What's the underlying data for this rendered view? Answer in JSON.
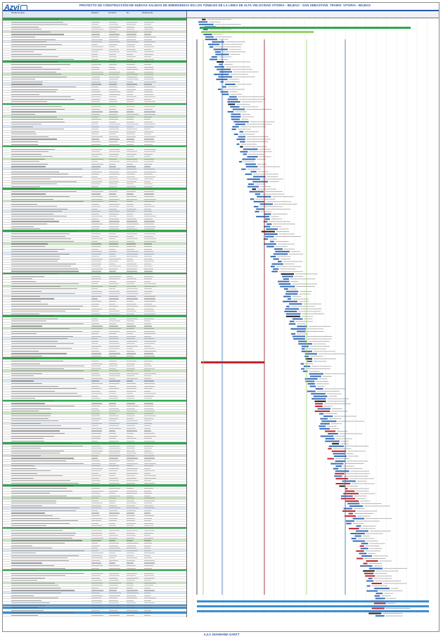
{
  "header": {
    "logo": "Azvi",
    "title": "PROYECTO DE CONSTRUCCIÓN DE NUEVAS SALIDAS DE EMERGENCIA EN LOS TÚNELES DE LA LÍNEA DE ALTA VELOCIDAD VITORIA - BILBAO - SAN SEBASTIÁN. TRAMO: VITORIA - BILBAO"
  },
  "table": {
    "columns": [
      "Nombre de tarea",
      "Duración",
      "Comienzo",
      "Fin",
      "Predecesoras"
    ]
  },
  "footer": {
    "caption": "A.2.2. DIAGRAMA GANTT"
  },
  "colors": {
    "accent_blue": "#2a55a4",
    "summary_green": "#2ba84a",
    "bar_blue": "#3b6fb6",
    "bar_red": "#c0282d",
    "link_green": "#9ccf6a"
  }
}
